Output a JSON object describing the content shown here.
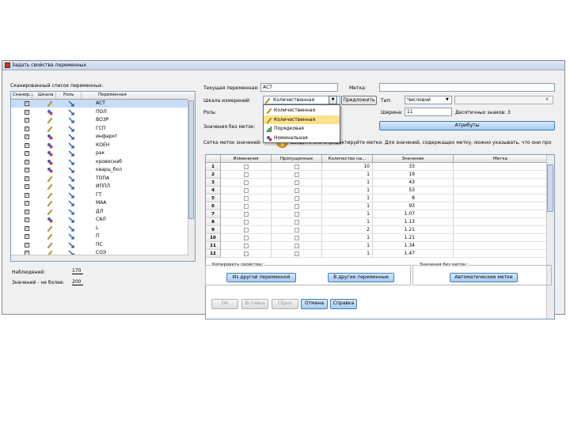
{
  "window": {
    "title": "Задать свойства переменных"
  },
  "list": {
    "label": "Сканированный список переменных:",
    "headers": [
      "Сканир...",
      "Шкала",
      "Роль",
      "Переменная"
    ],
    "rows": [
      {
        "name": "АСТ",
        "type": "scale",
        "sel": true
      },
      {
        "name": "ПОЛ",
        "type": "nominal"
      },
      {
        "name": "ВОЗР",
        "type": "scale"
      },
      {
        "name": "ГСП",
        "type": "scale"
      },
      {
        "name": "инфаркт",
        "type": "nominal"
      },
      {
        "name": "КОЕН",
        "type": "nominal"
      },
      {
        "name": "рак",
        "type": "nominal"
      },
      {
        "name": "кровоснаб",
        "type": "nominal"
      },
      {
        "name": "кварц_бол",
        "type": "nominal"
      },
      {
        "name": "ТОПА",
        "type": "scale"
      },
      {
        "name": "ИППЛ",
        "type": "scale"
      },
      {
        "name": "ГТ",
        "type": "scale"
      },
      {
        "name": "МАА",
        "type": "scale"
      },
      {
        "name": "ДЛ",
        "type": "scale"
      },
      {
        "name": "САЛ",
        "type": "nominal"
      },
      {
        "name": "L",
        "type": "scale"
      },
      {
        "name": "П",
        "type": "scale"
      },
      {
        "name": "ПС",
        "type": "scale"
      },
      {
        "name": "СОЭ",
        "type": "scale"
      }
    ]
  },
  "cases": {
    "label": "Наблюдений:",
    "value": "170"
  },
  "values_limit": {
    "label": "Значений - не более:",
    "value": "200"
  },
  "current": {
    "label": "Текущая переменная:",
    "value": "АСТ"
  },
  "measure": {
    "label": "Шкала измерений:",
    "value": "Количественная"
  },
  "suggest_button": "Предложить",
  "role": {
    "label": "Роль:"
  },
  "unlabeled": {
    "label": "Значения без меток:"
  },
  "label_field": {
    "label": "Метка:",
    "value": ""
  },
  "type_field": {
    "label": "Тип:",
    "value": "Числовой"
  },
  "width_field": {
    "label": "Ширина:",
    "value": "11",
    "decimals_label": "Десятичных знаков:",
    "decimals_value": "3"
  },
  "attributes_button": "Атрибуты",
  "measure_options": [
    {
      "label": "Количественная",
      "icon": "scale-icon"
    },
    {
      "label": "Количественная",
      "icon": "scale-icon",
      "sel": true
    },
    {
      "label": "Порядковая",
      "icon": "ordinal-icon"
    },
    {
      "label": "Номинальная",
      "icon": "nominal-icon"
    }
  ],
  "info_text": "Введите или отредактируйте метки. Для значений, содержащих метку, можно указывать, что они пропущены.",
  "info_prefix": "Сетка меток значений:",
  "grid": {
    "headers": [
      "Изменения",
      "Пропущенные",
      "Количество на...",
      "Значение",
      "Метка"
    ],
    "rows": [
      {
        "n": "1",
        "count": "10",
        "value": "33"
      },
      {
        "n": "2",
        "count": "1",
        "value": "19"
      },
      {
        "n": "3",
        "count": "1",
        "value": "43"
      },
      {
        "n": "4",
        "count": "1",
        "value": "53"
      },
      {
        "n": "5",
        "count": "1",
        "value": "8"
      },
      {
        "n": "6",
        "count": "1",
        "value": "93"
      },
      {
        "n": "7",
        "count": "1",
        "value": "1.07"
      },
      {
        "n": "8",
        "count": "1",
        "value": "1.13"
      },
      {
        "n": "9",
        "count": "2",
        "value": "1.21"
      },
      {
        "n": "10",
        "count": "1",
        "value": "1.21"
      },
      {
        "n": "11",
        "count": "1",
        "value": "1.34"
      },
      {
        "n": "12",
        "count": "1",
        "value": "1.47"
      }
    ]
  },
  "copy_group": {
    "title": "Копировать свойства:",
    "from_button": "Из другой переменной",
    "to_button": "В другие переменные"
  },
  "unlabeled_group": {
    "title": "Значения без меток:",
    "auto_button": "Автоматические метки"
  },
  "footer": {
    "ok": "OK",
    "paste": "Вставка",
    "reset": "Сброс",
    "cancel": "Отмена",
    "help": "Справка"
  },
  "colors": {
    "accent": "#3c7fb1",
    "title_bar": "#c6d6ec",
    "selection": "#fce08a"
  }
}
